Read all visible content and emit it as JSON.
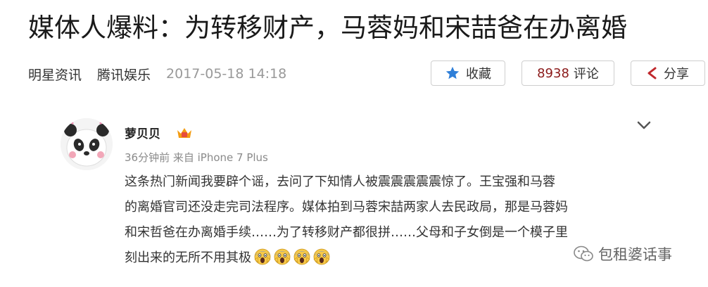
{
  "article": {
    "title": "媒体人爆料：为转移财产，马蓉妈和宋喆爸在办离婚",
    "source_primary": "明星资讯",
    "source_secondary": "腾讯娱乐",
    "datetime": "2017-05-18 14:18"
  },
  "actions": {
    "favorite_label": "收藏",
    "favorite_icon": "star-icon",
    "comment_count": "8938",
    "comment_label": "评论",
    "share_label": "分享",
    "share_icon": "share-icon"
  },
  "post": {
    "username": "萝贝贝",
    "meta": "36分钟前 来自 iPhone 7 Plus",
    "lines": [
      "这条热门新闻我要辟个谣，去问了下知情人被震震震震震惊了。王宝强和马蓉",
      "的离婚官司还没走完司法程序。媒体拍到马蓉宋喆两家人去民政局，那是马蓉妈",
      "和宋哲爸在办离婚手续……为了转移财产都很拼……父母和子女倒是一个模子里",
      "刻出来的无所不用其极"
    ],
    "emoji_count": 4,
    "emoji_name": "screaming-face-emoji"
  },
  "watermark": {
    "text": "包租婆话事",
    "icon": "wechat-icon"
  },
  "colors": {
    "comment_count": "#8b1a1a",
    "star": "#2f7fd8",
    "share": "#c0282c",
    "vip_badge": "#f39c12"
  }
}
